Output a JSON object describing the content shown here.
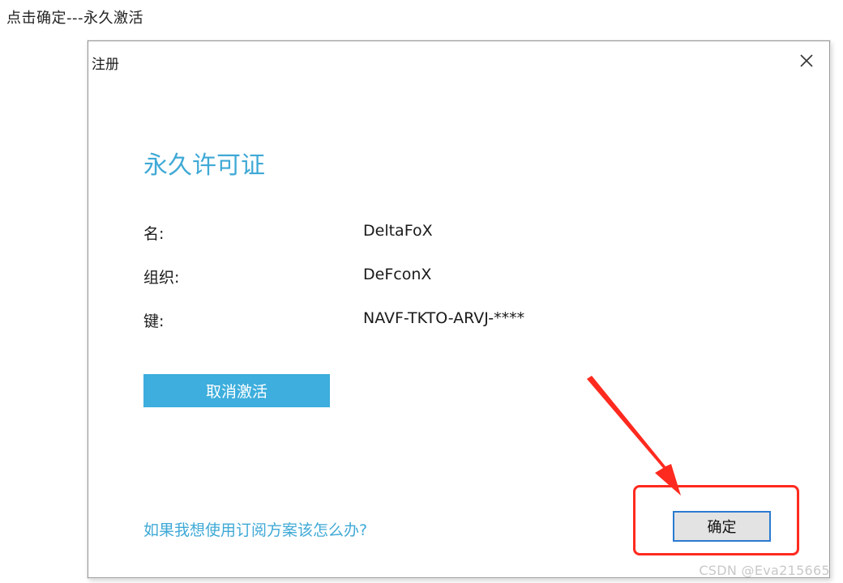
{
  "caption": "点击确定---永久激活",
  "dialog": {
    "title": "注册",
    "heading": "永久许可证",
    "rows": [
      {
        "label": "名:",
        "value": "DeltaFoX"
      },
      {
        "label": "组织:",
        "value": "DeFconX"
      },
      {
        "label": "键:",
        "value": "NAVF-TKTO-ARVJ-****"
      }
    ],
    "deactivate_label": "取消激活",
    "subscription_link": "如果我想使用订阅方案该怎么办?",
    "ok_label": "确定"
  },
  "watermark": "CSDN @Eva215665",
  "colors": {
    "accent": "#3fa9d6",
    "button_primary": "#3daedd",
    "annotation": "#ff2a1f"
  }
}
